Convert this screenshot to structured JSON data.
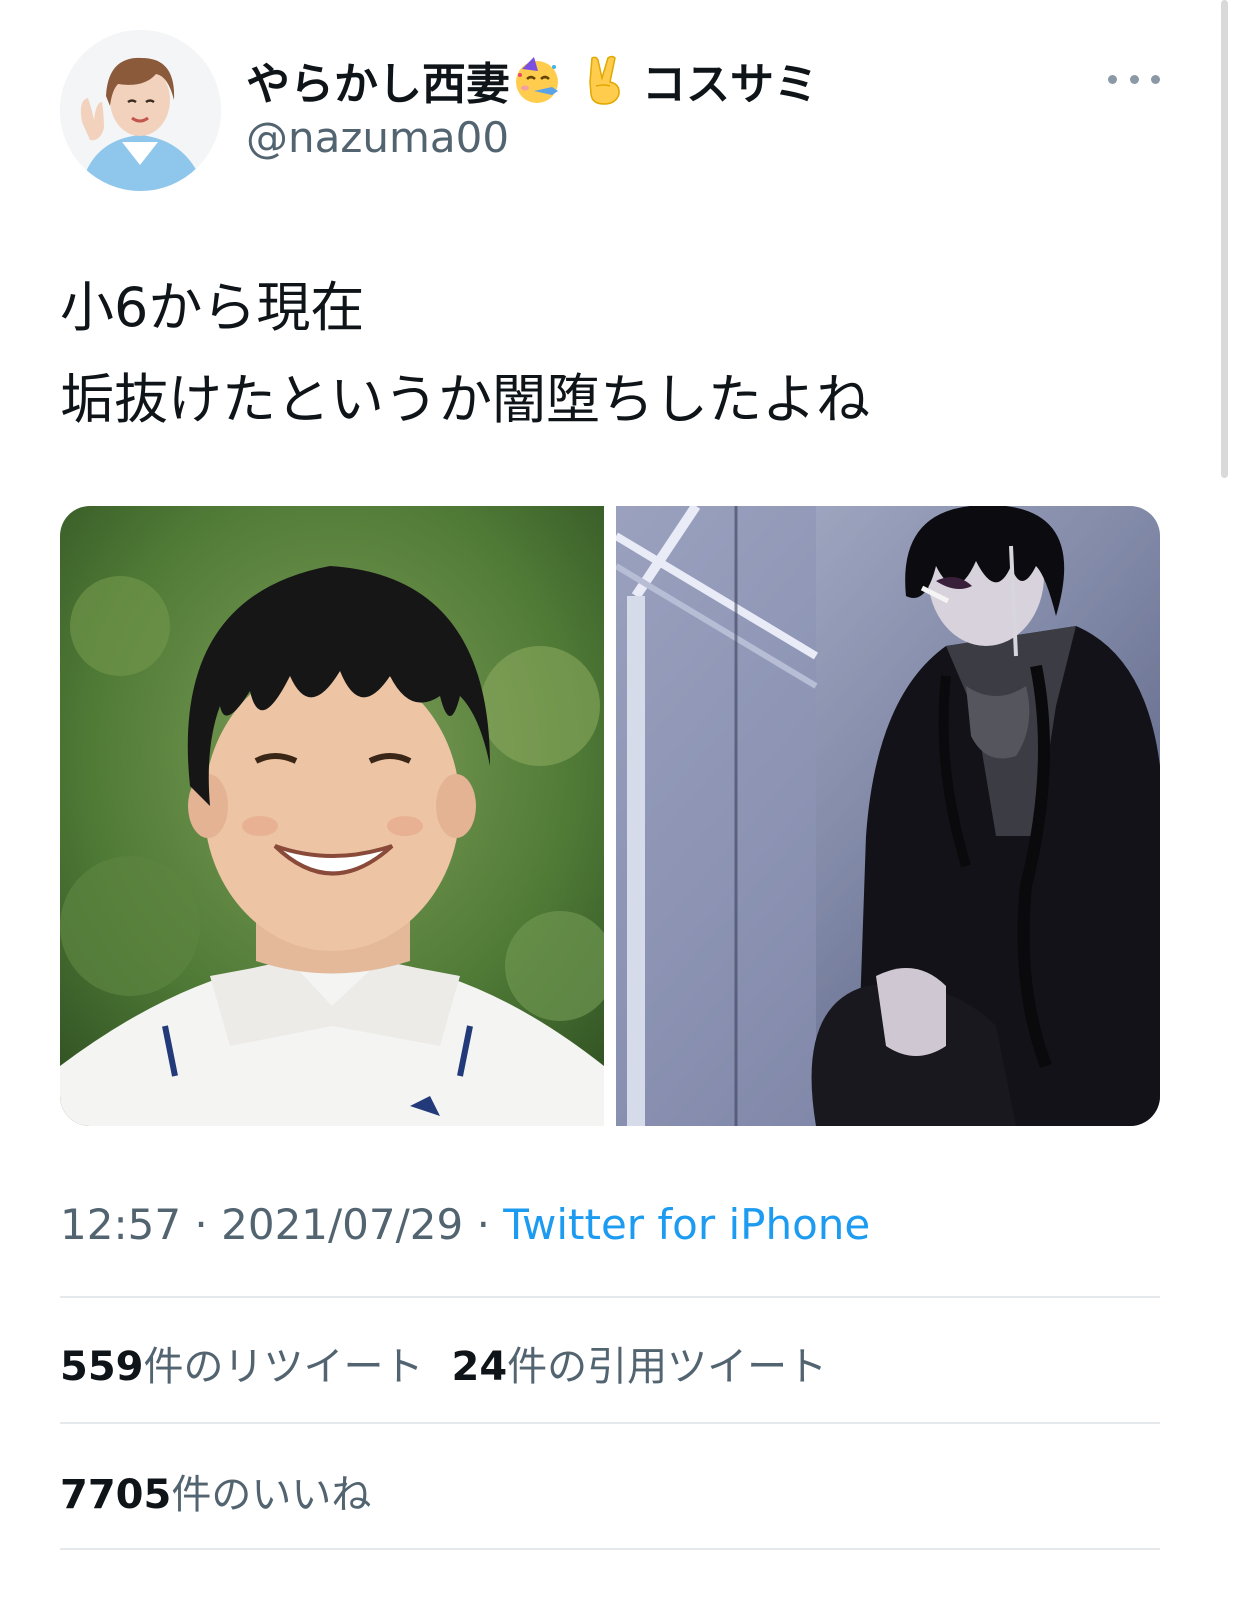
{
  "tweet": {
    "author": {
      "name_before_emoji": "やらかし西妻",
      "name_after_emoji": "コスサミ",
      "handle": "@nazuma00",
      "emoji_icons": [
        "partying-face-icon",
        "victory-hand-icon"
      ]
    },
    "text_lines": [
      "小6から現在",
      "垢抜けたというか闇堕ちしたよね"
    ],
    "media": [
      {
        "description_icon": "photo-child-icon"
      },
      {
        "description_icon": "photo-adult-icon"
      }
    ],
    "time": "12:57",
    "separator": "·",
    "date": "2021/07/29",
    "source": "Twitter for iPhone",
    "stats": {
      "retweets": {
        "count": "559",
        "label": "件のリツイート"
      },
      "quotes": {
        "count": "24",
        "label": "件の引用ツイート"
      },
      "likes": {
        "count": "7705",
        "label": "件のいいね"
      }
    }
  },
  "colors": {
    "text": "#0f1419",
    "secondary": "#536471",
    "link": "#1d9bf0",
    "divider": "#e6e9ec"
  }
}
